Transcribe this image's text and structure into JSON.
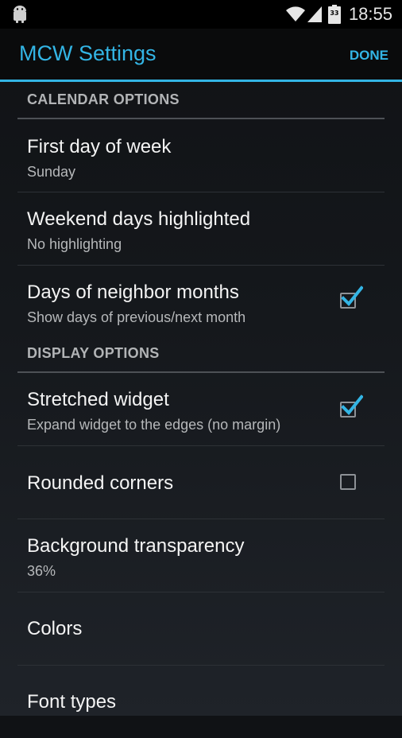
{
  "status_bar": {
    "time": "18:55",
    "battery_level": "33",
    "icons": [
      "android-icon",
      "wifi-icon",
      "signal-icon",
      "battery-icon"
    ]
  },
  "action_bar": {
    "title": "MCW Settings",
    "done_label": "DONE"
  },
  "colors": {
    "accent": "#33b5e5",
    "background": "#15181c",
    "category_text": "#b2b4b6"
  },
  "sections": [
    {
      "header": "CALENDAR OPTIONS",
      "items": [
        {
          "title": "First day of week",
          "summary": "Sunday"
        },
        {
          "title": "Weekend days highlighted",
          "summary": "No highlighting"
        },
        {
          "title": "Days of neighbor months",
          "summary": "Show days of previous/next month",
          "checked": true
        }
      ]
    },
    {
      "header": "DISPLAY OPTIONS",
      "items": [
        {
          "title": "Stretched widget",
          "summary": "Expand widget to the edges (no margin)",
          "checked": true
        },
        {
          "title": "Rounded corners",
          "checked": false
        },
        {
          "title": "Background transparency",
          "summary": "36%"
        },
        {
          "title": "Colors"
        },
        {
          "title": "Font types"
        }
      ]
    }
  ]
}
